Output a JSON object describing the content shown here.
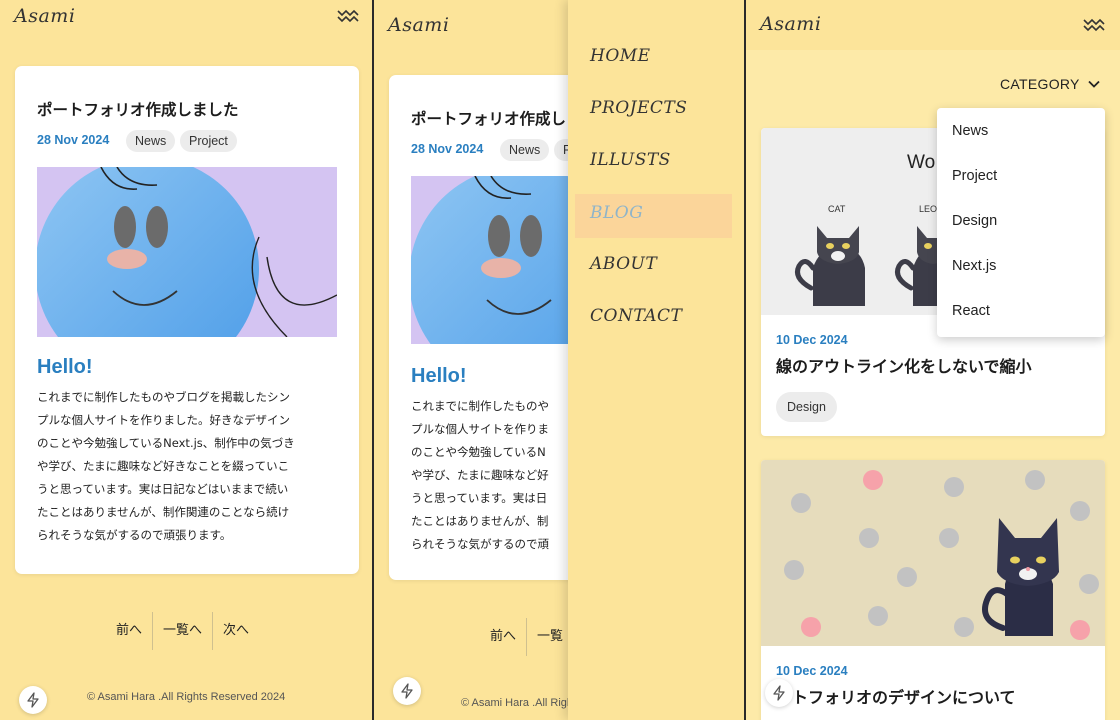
{
  "brand": {
    "logo": "Asami"
  },
  "article": {
    "title": "ポートフォリオ作成しました",
    "date": "28 Nov 2024",
    "tags": [
      "News",
      "Project"
    ],
    "heading": "Hello!",
    "body_lines": [
      "これまでに制作したものやブログを掲載したシン",
      "プルな個人サイトを作りました。好きなデザイン",
      "のことや今勉強しているNext.js、制作中の気づき",
      "や学び、たまに趣味など好きなことを綴っていこ",
      "うと思っています。実は日記などはいままで続い",
      "たことはありませんが、制作関連のことなら続け",
      "られそうな気がするので頑張ります。"
    ],
    "body_lines_cut": [
      "これまでに制作したものや",
      "プルな個人サイトを作りま",
      "のことや今勉強しているN",
      "や学び、たまに趣味など好",
      "うと思っています。実は日",
      "たことはありませんが、制",
      "られそうな気がするので頑"
    ],
    "title_cut": "ポートフォリオ作成し",
    "tag_cut": "P"
  },
  "pager": {
    "prev": "前へ",
    "list": "一覧へ",
    "next": "次へ",
    "list_cut": "一覧"
  },
  "footer": {
    "copyright": "© Asami Hara .All Rights Reserved 2024"
  },
  "nav": {
    "items": [
      "HOME",
      "PROJECTS",
      "ILLUSTS",
      "BLOG",
      "ABOUT",
      "CONTACT"
    ],
    "active": "BLOG"
  },
  "blog": {
    "category_label": "CATEGORY",
    "categories": [
      "News",
      "Project",
      "Design",
      "Next.js",
      "React"
    ],
    "posts": [
      {
        "date": "10 Dec 2024",
        "title": "線のアウトライン化をしないで縮小",
        "tag": "Design",
        "image_text": "Wo",
        "image_labels": [
          "CAT",
          "LEO"
        ]
      },
      {
        "date": "10 Dec 2024",
        "title": "ートフォリオのデザインについて"
      }
    ]
  },
  "colors": {
    "background": "#fce49a",
    "accent_blue": "#2a7fc0",
    "drawer_active": "#fbd59a",
    "tag_bg": "#ececec"
  },
  "icons": {
    "menu": "zigzag-menu-icon",
    "dropdown": "chevron-down-icon",
    "floating": "lightning-bolt-icon"
  }
}
